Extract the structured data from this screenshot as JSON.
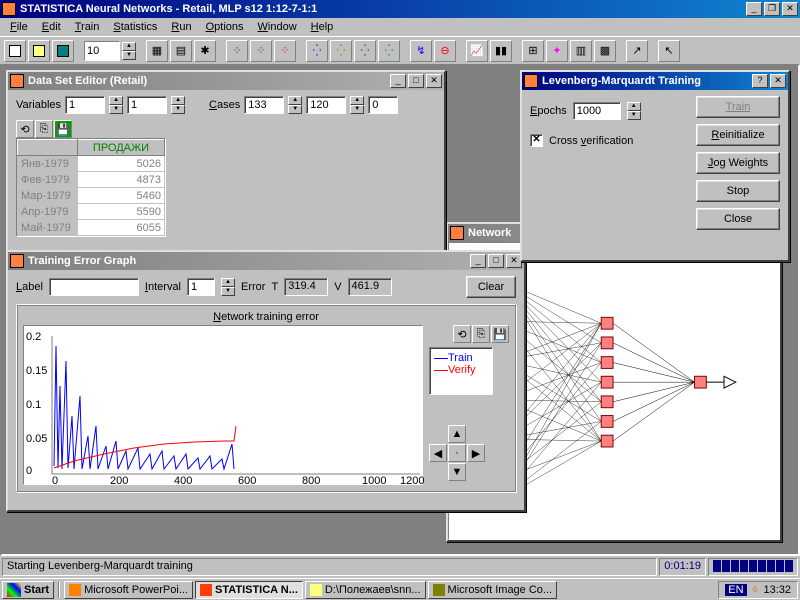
{
  "app": {
    "title": "STATISTICA Neural Networks - Retail, MLP s12 1:12-7-1:1",
    "menus": [
      "File",
      "Edit",
      "Train",
      "Statistics",
      "Run",
      "Options",
      "Window",
      "Help"
    ],
    "toolbar_number": "10"
  },
  "dse": {
    "title": "Data Set Editor (Retail)",
    "variables_label": "Variables",
    "cases_label": "Cases",
    "var1": "1",
    "var2": "1",
    "cases1": "133",
    "cases2": "120",
    "cases3": "0",
    "col_header": "ПРОДАЖИ",
    "rows": [
      {
        "label": "Янв-1979",
        "val": "5026"
      },
      {
        "label": "Фев-1979",
        "val": "4873"
      },
      {
        "label": "Мар-1979",
        "val": "5460"
      },
      {
        "label": "Апр-1979",
        "val": "5590"
      },
      {
        "label": "Май-1979",
        "val": "6055"
      }
    ]
  },
  "teg": {
    "title": "Training Error Graph",
    "label_label": "Label",
    "interval_label": "Interval",
    "interval": "1",
    "error_label": "Error",
    "t_label": "T",
    "t_val": "319.4",
    "v_label": "V",
    "v_val": "461.9",
    "clear": "Clear",
    "chart_title": "Network training error",
    "legend_train": "Train",
    "legend_verify": "Verify"
  },
  "lmt": {
    "title": "Levenberg-Marquardt Training",
    "epochs_label": "Epochs",
    "epochs": "1000",
    "cv_label": "Cross verification",
    "train": "Train",
    "reinit": "Reinitialize",
    "jog": "Jog Weights",
    "stop": "Stop",
    "close": "Close"
  },
  "net": {
    "title": "Network"
  },
  "status": {
    "msg": "Starting Levenberg-Marquardt training",
    "timer": "0:01:19"
  },
  "taskbar": {
    "start": "Start",
    "items": [
      "Microsoft PowerPoi...",
      "STATISTICA N...",
      "D:\\Полежаев\\snn...",
      "Microsoft Image Co..."
    ],
    "lang": "EN",
    "clock": "13:32"
  },
  "chart_data": {
    "type": "line",
    "title": "Network training error",
    "xlabel": "",
    "ylabel": "",
    "xlim": [
      0,
      1200
    ],
    "ylim": [
      0,
      0.2
    ],
    "xticks": [
      0,
      200,
      400,
      600,
      800,
      1000,
      1200
    ],
    "yticks": [
      0,
      0.05,
      0.1,
      0.15,
      0.2
    ],
    "series": [
      {
        "name": "Train",
        "color": "#0000ff",
        "values_approx": "noisy decaying spikes from ~0.19 at epoch≈5 down to ~0.01 baseline with periodic spikes up to ~0.04 over 0–580"
      },
      {
        "name": "Verify",
        "color": "#ff0000",
        "values_approx": "rises from ~0.02 at epoch 0 to ~0.05 by epoch≈300 and plateaus ~0.05 to epoch≈580"
      }
    ],
    "x_data_extent": 580
  }
}
